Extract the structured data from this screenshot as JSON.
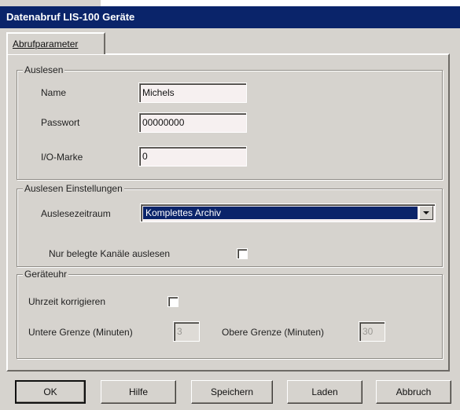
{
  "window": {
    "title": "Datenabruf LIS-100 Geräte"
  },
  "tabs": [
    {
      "label": "Abrufparameter"
    }
  ],
  "auslesen": {
    "legend": "Auslesen",
    "name_label": "Name",
    "name_value": "Michels",
    "passwort_label": "Passwort",
    "passwort_value": "00000000",
    "io_label": "I/O-Marke",
    "io_value": "0"
  },
  "einstellungen": {
    "legend": "Auslesen Einstellungen",
    "zeitraum_label": "Auslesezeitraum",
    "zeitraum_value": "Komplettes Archiv",
    "kanaele_label": "Nur belegte Kanäle auslesen",
    "kanaele_checked": false
  },
  "geraeteuhr": {
    "legend": "Geräteuhr",
    "korrigieren_label": "Uhrzeit korrigieren",
    "korrigieren_checked": false,
    "untere_label": "Untere Grenze (Minuten)",
    "untere_value": "3",
    "obere_label": "Obere  Grenze (Minuten)",
    "obere_value": "30"
  },
  "buttons": {
    "ok": "OK",
    "hilfe": "Hilfe",
    "speichern": "Speichern",
    "laden": "Laden",
    "abbruch": "Abbruch"
  },
  "colors": {
    "titlebar": "#0a246a",
    "dialog_bg": "#d6d3ce",
    "selection": "#0a246a"
  }
}
